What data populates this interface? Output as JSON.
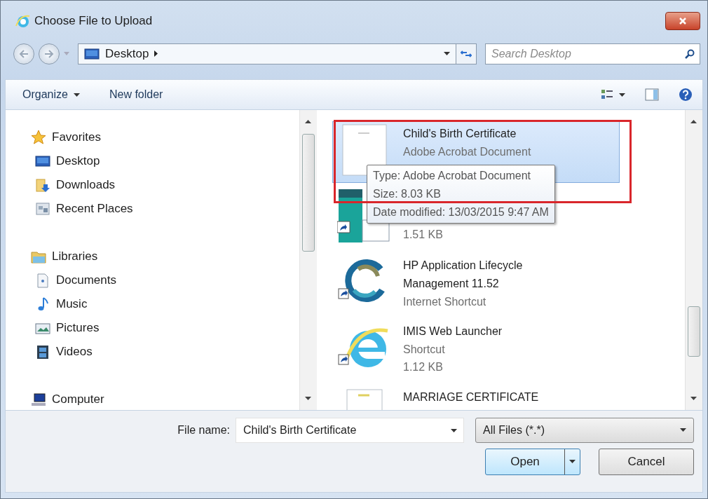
{
  "window": {
    "title": "Choose File to Upload"
  },
  "address_bar": {
    "location": "Desktop"
  },
  "search": {
    "placeholder": "Search Desktop"
  },
  "toolbar": {
    "organize": "Organize",
    "new_folder": "New folder"
  },
  "sidebar": {
    "groups": [
      {
        "label": "Favorites",
        "kind": "favorites",
        "children": [
          {
            "label": "Desktop",
            "kind": "desktop"
          },
          {
            "label": "Downloads",
            "kind": "downloads"
          },
          {
            "label": "Recent Places",
            "kind": "recent"
          }
        ]
      },
      {
        "label": "Libraries",
        "kind": "libraries",
        "children": [
          {
            "label": "Documents",
            "kind": "documents"
          },
          {
            "label": "Music",
            "kind": "music"
          },
          {
            "label": "Pictures",
            "kind": "pictures"
          },
          {
            "label": "Videos",
            "kind": "videos"
          }
        ]
      },
      {
        "label": "Computer",
        "kind": "computer"
      }
    ]
  },
  "files": [
    {
      "name": "Child's Birth Certificate",
      "type": "Adobe Acrobat Document",
      "kind": "pdf",
      "selected": true
    },
    {
      "size": "1.51 KB",
      "kind": "shortcut-doc",
      "selected": false
    },
    {
      "name": "HP Application Lifecycle Management 11.52",
      "type": "Internet Shortcut",
      "kind": "hp",
      "selected": false
    },
    {
      "name": "IMIS Web Launcher",
      "type": "Shortcut",
      "size": "1.12 KB",
      "kind": "ie",
      "selected": false
    },
    {
      "name": "MARRIAGE CERTIFICATE",
      "kind": "doc",
      "selected": false
    }
  ],
  "tooltip": {
    "lines": [
      "Type: Adobe Acrobat Document",
      "Size: 8.03 KB",
      "Date modified: 13/03/2015 9:47 AM"
    ]
  },
  "footer": {
    "file_name_label": "File name:",
    "file_name": "Child's Birth Certificate",
    "file_type": "All Files (*.*)",
    "buttons": [
      {
        "label": "Open",
        "kind": "split",
        "default": true
      },
      {
        "label": "Cancel",
        "kind": "plain",
        "default": false
      }
    ]
  }
}
